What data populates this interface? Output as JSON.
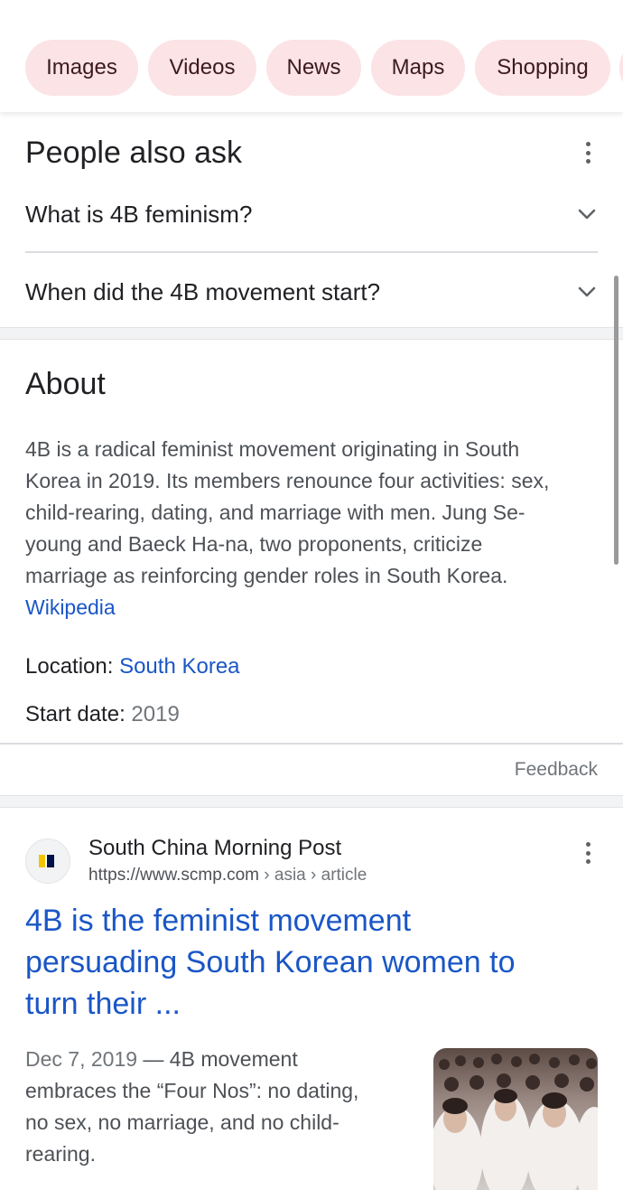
{
  "chips": [
    {
      "label": "Images"
    },
    {
      "label": "Videos"
    },
    {
      "label": "News"
    },
    {
      "label": "Maps"
    },
    {
      "label": "Shopping"
    }
  ],
  "people_also_ask": {
    "title": "People also ask",
    "questions": [
      {
        "text": "What is 4B feminism?"
      },
      {
        "text": "When did the 4B movement start?"
      }
    ]
  },
  "about": {
    "title": "About",
    "description_lines": [
      "4B is a radical feminist movement originating in South",
      "Korea in 2019. Its members renounce four activities: sex,",
      "child-rearing, dating, and marriage with men. Jung Se-",
      "young and Baeck Ha-na, two proponents, criticize",
      "marriage as reinforcing gender roles in South Korea."
    ],
    "source_link": "Wikipedia",
    "location_label": "Location:",
    "location_value": "South Korea",
    "start_label": "Start date:",
    "start_value": "2019",
    "feedback": "Feedback"
  },
  "result": {
    "site_name": "South China Morning Post",
    "url": "https://www.scmp.com",
    "breadcrumb": " › asia › article",
    "title_lines": [
      "4B is the feminist movement",
      "persuading South Korean women to",
      "turn their ..."
    ],
    "snippet_date": "Dec 7, 2019",
    "snippet_lines": [
      " — 4B movement",
      "embraces the “Four Nos”: no dating,",
      "no sex, no marriage, and no child-",
      "rearing."
    ]
  },
  "colors": {
    "chip_bg": "#fbe3e6",
    "link_blue": "#1a56c6",
    "text_dark": "#202124",
    "text_gray": "#4d5156"
  }
}
